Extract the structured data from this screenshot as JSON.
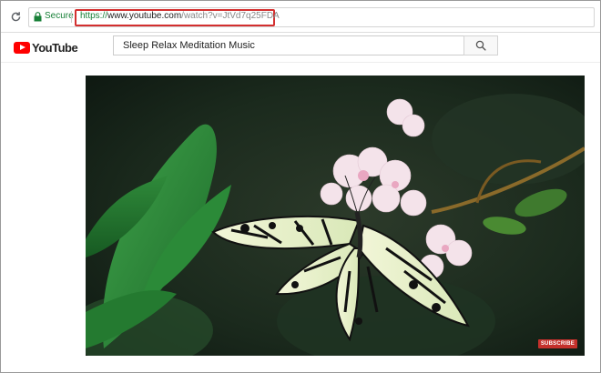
{
  "browser": {
    "secure_label": "Secure",
    "url_protocol": "https://",
    "url_host": "www.youtube.com",
    "url_path": "/watch?v=JtVd7q25FDA"
  },
  "youtube": {
    "logo_text": "YouTube",
    "search_value": "Sleep Relax Meditation Music"
  },
  "video": {
    "subscribe_label": "SUBSCRIBE"
  },
  "colors": {
    "secure_green": "#188038",
    "highlight_red": "#d32f2f",
    "youtube_red": "#ff0000",
    "subscribe_red": "#c4302b"
  }
}
